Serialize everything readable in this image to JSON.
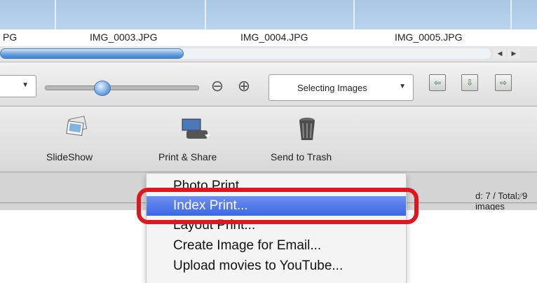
{
  "filenames": [
    "PG",
    "IMG_0003.JPG",
    "IMG_0004.JPG",
    "IMG_0005.JPG"
  ],
  "scroll": {
    "left_arrow": "◀",
    "right_arrow": "▶"
  },
  "toolbar": {
    "zoom_out": "⊖",
    "zoom_in": "⊕",
    "mode_select": "Selecting Images",
    "slider_level": 0.43,
    "nav_icons": [
      "arrow-up-left-icon",
      "arrow-down-icon",
      "arrow-right-icon"
    ]
  },
  "actions": [
    {
      "label": "SlideShow",
      "icon": "slideshow-icon"
    },
    {
      "label": "Print & Share",
      "icon": "printer-icon"
    },
    {
      "label": "Send to Trash",
      "icon": "trash-icon"
    }
  ],
  "status": {
    "text": "d: 7 / Total: 9 images"
  },
  "menu": {
    "items": [
      "Photo Print...",
      "Index Print...",
      "Layout Print...",
      "Create Image for Email...",
      "Upload movies to YouTube..."
    ],
    "active_index": 1
  },
  "colors": {
    "highlight": "#e0161f",
    "menu_active": "#3d68e6"
  }
}
